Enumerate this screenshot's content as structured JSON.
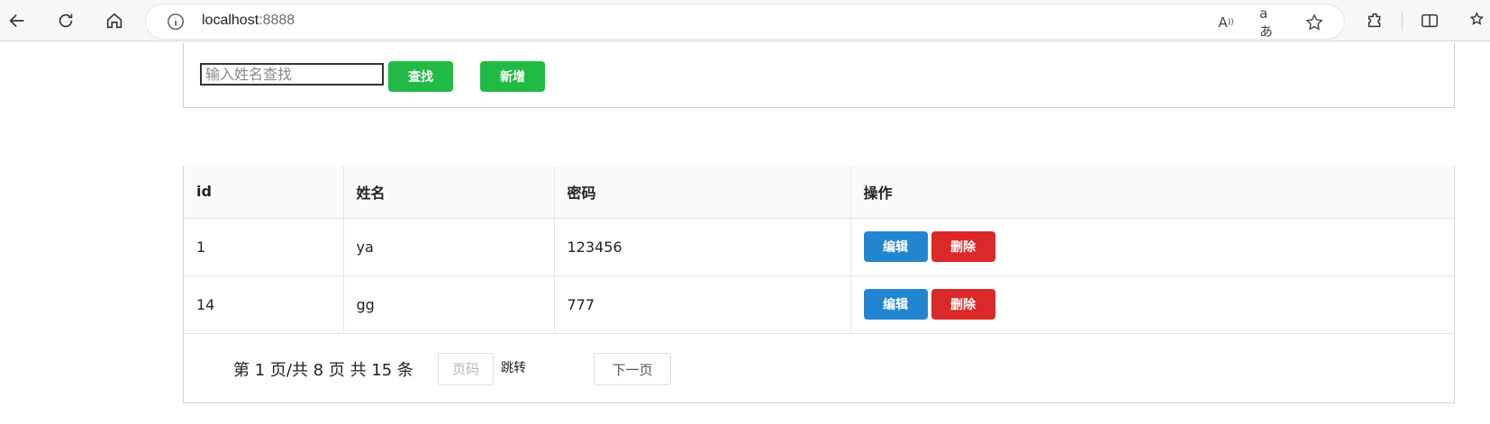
{
  "browser": {
    "url_host": "localhost",
    "url_port": ":8888"
  },
  "search": {
    "placeholder": "输入姓名查找",
    "search_label": "查找",
    "add_label": "新增"
  },
  "table": {
    "headers": [
      "id",
      "姓名",
      "密码",
      "操作"
    ],
    "rows": [
      {
        "id": "1",
        "name": "ya",
        "password": "123456",
        "edit_label": "编辑",
        "delete_label": "删除"
      },
      {
        "id": "14",
        "name": "gg",
        "password": "777",
        "edit_label": "编辑",
        "delete_label": "删除"
      }
    ]
  },
  "pagination": {
    "info": "第 1 页/共 8 页 共 15 条",
    "page_placeholder": "页码",
    "jump_label": "跳转",
    "next_label": "下一页"
  },
  "colors": {
    "green": "#21ba45",
    "blue": "#2185d0",
    "red": "#db2828"
  }
}
